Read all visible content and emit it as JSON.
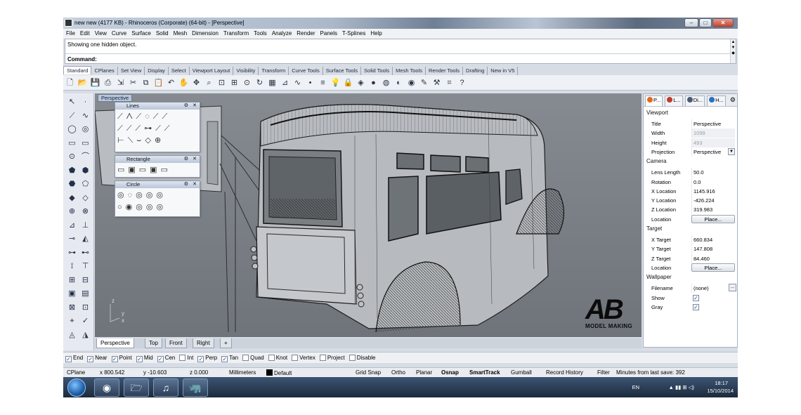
{
  "window": {
    "title": "new new (4177 KB) - Rhinoceros (Corporate) (64-bit) - [Perspective]",
    "min": "–",
    "max": "□",
    "close": "✕"
  },
  "menu": [
    "File",
    "Edit",
    "View",
    "Curve",
    "Surface",
    "Solid",
    "Mesh",
    "Dimension",
    "Transform",
    "Tools",
    "Analyze",
    "Render",
    "Panels",
    "T-Splines",
    "Help"
  ],
  "command": {
    "history": "Showing one hidden object.",
    "prompt": "Command:"
  },
  "toolbar_tabs": [
    "Standard",
    "CPlanes",
    "Set View",
    "Display",
    "Select",
    "Viewport Layout",
    "Visibility",
    "Transform",
    "Curve Tools",
    "Surface Tools",
    "Solid Tools",
    "Mesh Tools",
    "Render Tools",
    "Drafting",
    "New in V5"
  ],
  "toolbar_icons": [
    "new-file-icon",
    "open-icon",
    "save-icon",
    "print-icon",
    "import-icon",
    "cut-icon",
    "copy-icon",
    "paste-icon",
    "undo-icon",
    "pan-hand-icon",
    "move-view-icon",
    "zoom-icon",
    "zoom-window-icon",
    "zoom-extents-icon",
    "zoom-selected-icon",
    "rotate-view-icon",
    "four-viewports-icon",
    "cplane-icon",
    "curve-icon",
    "point-icon",
    "layer-icon",
    "light-bulb-icon",
    "lock-icon",
    "material-icon",
    "render-icon",
    "sphere-icon",
    "shaded-icon",
    "rendered-icon",
    "properties-icon",
    "tools-icon",
    "grid-icon",
    "help-icon"
  ],
  "viewport": {
    "label": "Perspective",
    "panels": [
      {
        "title": "Lines",
        "glyphs": [
          "⟋⋀⟋◌⟋⟋",
          "⟋⟋⟋⊶⟋⟋",
          "⊢⟍⌣◇⊕"
        ]
      },
      {
        "title": "Rectangle",
        "glyphs": [
          "▭▣▭▣▭"
        ]
      },
      {
        "title": "Circle",
        "glyphs": [
          "◎◌◎◎◎",
          "○◉◎◎◎"
        ]
      }
    ],
    "axis_z": "z",
    "axis_y": "y",
    "axis_x": "x",
    "logo_text": "AB",
    "logo_caption": "MODEL MAKING"
  },
  "view_tabs": [
    "Perspective",
    "Top",
    "Front",
    "Right"
  ],
  "view_tab_add": "+",
  "osnaps": [
    {
      "label": "End",
      "checked": true
    },
    {
      "label": "Near",
      "checked": true
    },
    {
      "label": "Point",
      "checked": true
    },
    {
      "label": "Mid",
      "checked": true
    },
    {
      "label": "Cen",
      "checked": true
    },
    {
      "label": "Int",
      "checked": false
    },
    {
      "label": "Perp",
      "checked": true
    },
    {
      "label": "Tan",
      "checked": true
    },
    {
      "label": "Quad",
      "checked": false
    },
    {
      "label": "Knot",
      "checked": false
    },
    {
      "label": "Vertex",
      "checked": false
    },
    {
      "label": "Project",
      "checked": false
    },
    {
      "label": "Disable",
      "checked": false
    }
  ],
  "status": {
    "cplane": "CPlane",
    "x": "x 800.542",
    "y": "y -10.603",
    "z": "z 0.000",
    "units": "Millimeters",
    "layer": "Default",
    "grid_snap": "Grid Snap",
    "ortho": "Ortho",
    "planar": "Planar",
    "osnap": "Osnap",
    "smarttrack": "SmartTrack",
    "gumball": "Gumball",
    "record_history": "Record History",
    "filter": "Filter",
    "save_info": "Minutes from last save: 392"
  },
  "panel_tabs": [
    {
      "label": "P...",
      "color": "#e06a1e"
    },
    {
      "label": "L...",
      "color": "#c0392b"
    },
    {
      "label": "Di...",
      "color": "#4a5a73"
    },
    {
      "label": "H...",
      "color": "#2d6fc2"
    }
  ],
  "properties": {
    "viewport_heading": "Viewport",
    "viewport_rows": [
      {
        "k": "Title",
        "v": "Perspective"
      },
      {
        "k": "Width",
        "v": "1099",
        "disabled": true
      },
      {
        "k": "Height",
        "v": "493",
        "disabled": true
      },
      {
        "k": "Projection",
        "v": "Perspective",
        "dropdown": true
      }
    ],
    "camera_heading": "Camera",
    "camera_rows": [
      {
        "k": "Lens Length",
        "v": "50.0"
      },
      {
        "k": "Rotation",
        "v": "0.0"
      },
      {
        "k": "X Location",
        "v": "1145.916"
      },
      {
        "k": "Y Location",
        "v": "-426.224"
      },
      {
        "k": "Z Location",
        "v": "319.983"
      },
      {
        "k": "Location",
        "button": "Place..."
      }
    ],
    "target_heading": "Target",
    "target_rows": [
      {
        "k": "X Target",
        "v": "660.834"
      },
      {
        "k": "Y Target",
        "v": "147.808"
      },
      {
        "k": "Z Target",
        "v": "84.460"
      },
      {
        "k": "Location",
        "button": "Place..."
      }
    ],
    "wallpaper_heading": "Wallpaper",
    "wallpaper_rows": [
      {
        "k": "Filename",
        "v": "(none)",
        "browse": "..."
      },
      {
        "k": "Show",
        "check": true
      },
      {
        "k": "Gray",
        "check": true
      }
    ]
  },
  "taskbar": {
    "apps": [
      "chrome-icon",
      "explorer-icon",
      "itunes-icon",
      "rhino-icon"
    ],
    "lang": "EN",
    "time": "18:17",
    "date": "15/10/2014"
  }
}
